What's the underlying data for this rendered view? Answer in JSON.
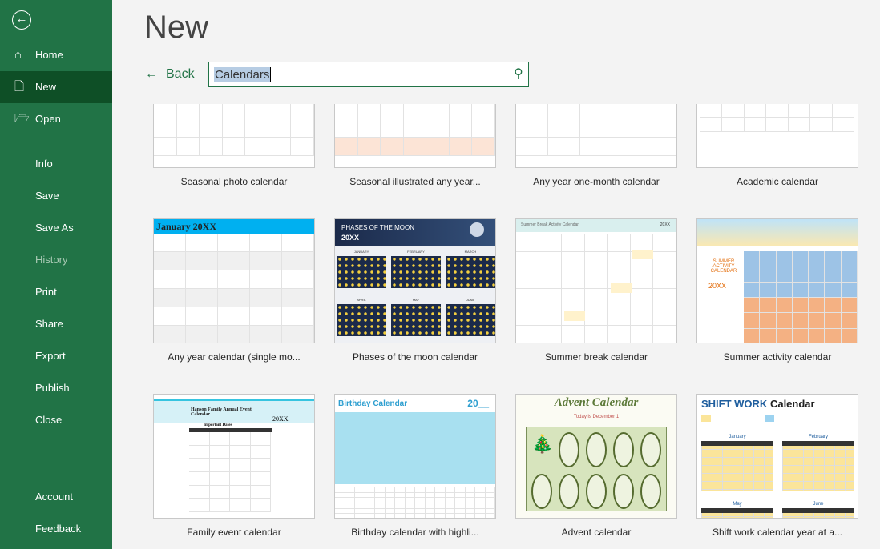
{
  "sidebar": {
    "back_icon": "back-arrow-circle-icon",
    "items": [
      {
        "label": "Home",
        "icon": "home-icon"
      },
      {
        "label": "New",
        "icon": "new-document-icon",
        "selected": true
      },
      {
        "label": "Open",
        "icon": "folder-open-icon"
      },
      {
        "label": "Info"
      },
      {
        "label": "Save"
      },
      {
        "label": "Save As"
      },
      {
        "label": "History",
        "disabled": true
      },
      {
        "label": "Print"
      },
      {
        "label": "Share"
      },
      {
        "label": "Export"
      },
      {
        "label": "Publish"
      },
      {
        "label": "Close"
      },
      {
        "label": "Account"
      },
      {
        "label": "Feedback"
      }
    ]
  },
  "page_title": "New",
  "back_label": "Back",
  "search": {
    "value": "Calendars"
  },
  "templates": [
    {
      "label": "Seasonal photo calendar"
    },
    {
      "label": "Seasonal illustrated any year..."
    },
    {
      "label": "Any year one-month calendar"
    },
    {
      "label": "Academic calendar"
    },
    {
      "label": "Any year calendar (single mo...",
      "heading": "January 20XX"
    },
    {
      "label": "Phases of the moon calendar",
      "heading": "PHASES OF THE MOON",
      "sub": "20XX",
      "months": [
        "JANUARY",
        "FEBRUARY",
        "MARCH",
        "APRIL",
        "MAY",
        "JUNE"
      ]
    },
    {
      "label": "Summer break calendar",
      "heading": "Summer Break Activity Calendar",
      "sub": "20XX"
    },
    {
      "label": "Summer activity calendar",
      "heading": "SUMMER ACTIVITY CALENDAR",
      "sub": "20XX"
    },
    {
      "label": "Family event calendar",
      "heading": "Hanson Family Annual Event Calendar",
      "sub": "Important Dates",
      "year": "20XX"
    },
    {
      "label": "Birthday calendar with highli...",
      "heading": "Birthday Calendar",
      "sub": "20__"
    },
    {
      "label": "Advent calendar",
      "heading": "Advent Calendar",
      "sub": "Today is December 1"
    },
    {
      "label": "Shift work calendar year at a...",
      "heading": "SHIFT WORK",
      "sub": "Calendar",
      "months": [
        "January",
        "February",
        "May",
        "June"
      ]
    }
  ],
  "colors": {
    "accent": "#217346",
    "selected": "#0e4f26"
  }
}
